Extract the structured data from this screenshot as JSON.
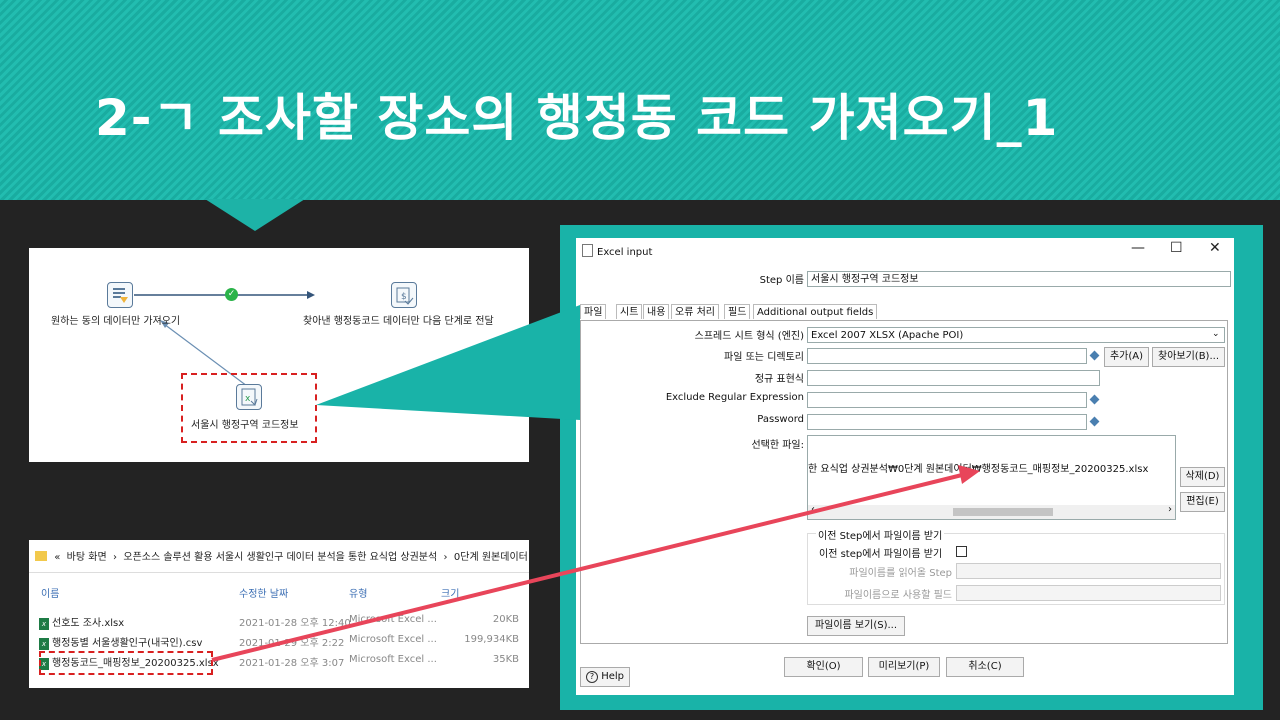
{
  "title": "2-ㄱ 조사할 장소의 행정동 코드 가져오기_1",
  "flow": {
    "node_left_label": "원하는 동의 데이터만 가져오기",
    "node_right_label": "찾아낸 행정동코드 데이터만 다음 단계로 전달",
    "node_bottom_label": "서울시 행정구역 코드정보",
    "ok_glyph": "✓"
  },
  "explorer": {
    "breadcrumb": [
      "«",
      "바탕 화면",
      "›",
      "오픈소스 솔루션 활용 서울시 생활인구 데이터 분석을 통한 요식업 상권분석",
      "›",
      "0단계 원본데이터"
    ],
    "columns": [
      "이름",
      "수정한 날짜",
      "유형",
      "크기"
    ],
    "rows": [
      {
        "name": "선호도 조사.xlsx",
        "date": "2021-01-28 오후 12:40",
        "type": "Microsoft Excel ...",
        "size": "20KB"
      },
      {
        "name": "행정동별 서울생활인구(내국인).csv",
        "date": "2021-01-29 오후 2:22",
        "type": "Microsoft Excel ...",
        "size": "199,934KB"
      },
      {
        "name": "행정동코드_매핑정보_20200325.xlsx",
        "date": "2021-01-28 오후 3:07",
        "type": "Microsoft Excel ...",
        "size": "35KB"
      }
    ]
  },
  "dialog": {
    "title": "Excel input",
    "window_controls": [
      "—",
      "☐",
      "✕"
    ],
    "step_label": "Step 이름",
    "step_value": "서울시 행정구역 코드정보",
    "tabs": [
      "파일",
      "시트",
      "내용",
      "오류 처리",
      "필드",
      "Additional output fields"
    ],
    "spreadsheet_label": "스프레드 시트 형식 (엔진)",
    "spreadsheet_value": "Excel 2007 XLSX (Apache POI)",
    "file_dir_label": "파일 또는 디렉토리",
    "add_button": "추가(A)",
    "browse_button": "찾아보기(B)...",
    "regex_label": "정규 표현식",
    "exclude_regex_label": "Exclude Regular Expression",
    "password_label": "Password",
    "selected_files_label": "선택한 파일:",
    "selected_file_value": "한 요식업 상권분석₩0단계 원본데이터₩행정동코드_매핑정보_20200325.xlsx",
    "delete_button": "삭제(D)",
    "edit_button": "편집(E)",
    "prev_step_group": "이전 Step에서 파일이름 받기",
    "prev_step_checkbox": "이전 step에서 파일이름 받기",
    "read_step_label": "파일이름를 읽어올 Step",
    "use_field_label": "파일이름으로 사용할 필드",
    "show_filenames_button": "파일이름 보기(S)...",
    "ok_button": "확인(O)",
    "preview_button": "미리보기(P)",
    "cancel_button": "취소(C)",
    "help_button": "Help"
  },
  "colors": {
    "banner": "#1db3a7",
    "highlight": "#d82020",
    "arrow": "#e8455a"
  }
}
